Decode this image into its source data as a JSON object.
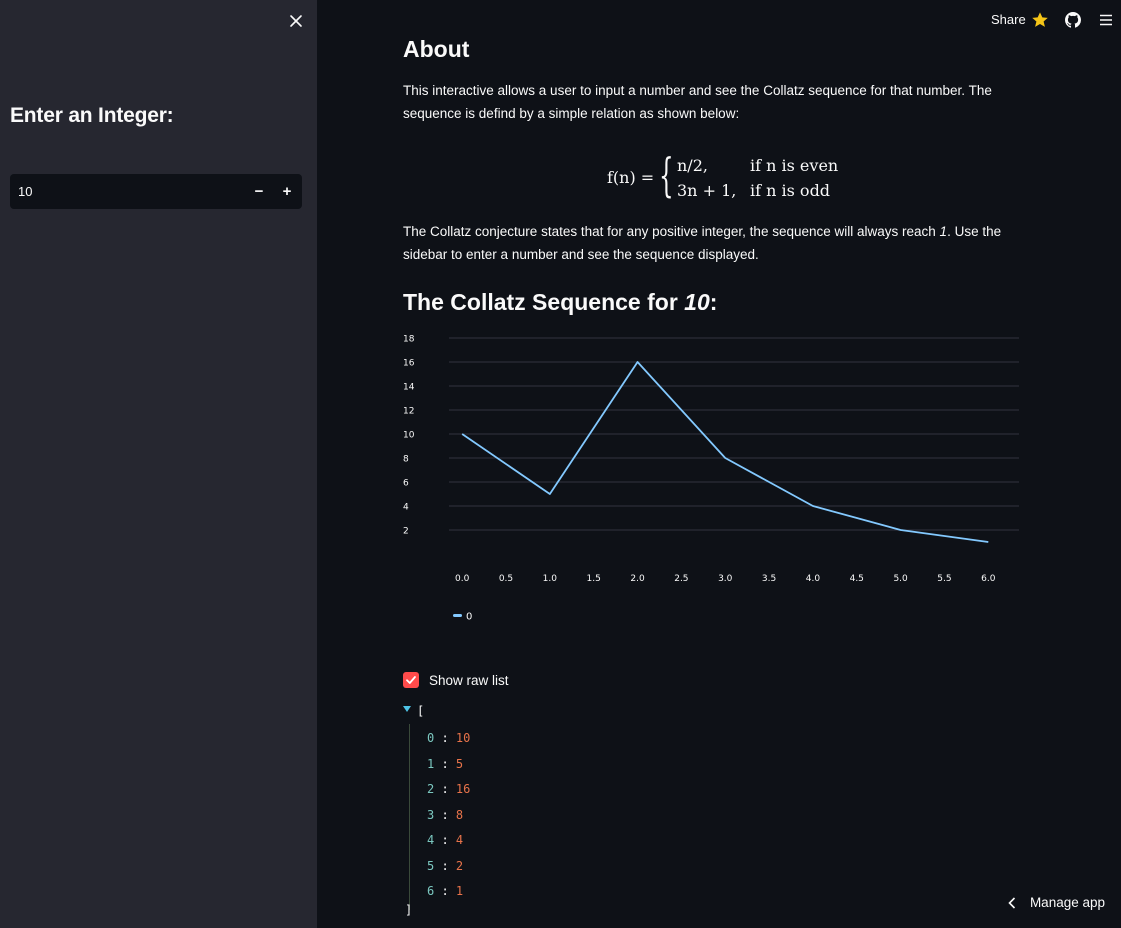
{
  "sidebar": {
    "title": "Enter an Integer:",
    "input_value": "10",
    "minus_label": "−",
    "plus_label": "+"
  },
  "topbar": {
    "share_label": "Share",
    "icons": [
      "star-icon",
      "github-icon",
      "hamburger-menu-icon"
    ],
    "star_color": "#f5c518"
  },
  "main": {
    "about_title": "About",
    "para1_line1": "This interactive allows a user to input a number and see the Collatz sequence for that number. The",
    "para1_line2": "sequence is defind by a simple relation as shown below:",
    "formula": {
      "lhs": "f(n) =",
      "row1_expr": "n/2,",
      "row1_cond": "if n is even",
      "row2_expr": "3n + 1,",
      "row2_cond": "if n is odd"
    },
    "para2_line1a": "The Collatz conjecture states that for any positive integer, the sequence will always reach ",
    "para2_line1_em": "1",
    "para2_line1b": ". Use the",
    "para2_line2": "sidebar to enter a number and see the sequence displayed.",
    "seq_title_prefix": "The Collatz Sequence for ",
    "seq_title_num": "10",
    "seq_title_suffix": ":",
    "checkbox_label": "Show raw list",
    "checkbox_checked": true,
    "manage_label": "Manage app"
  },
  "chart_data": {
    "type": "line",
    "x": [
      0,
      1,
      2,
      3,
      4,
      5,
      6
    ],
    "series": [
      {
        "name": "0",
        "values": [
          10,
          5,
          16,
          8,
          4,
          2,
          1
        ]
      }
    ],
    "x_ticks": [
      "0.0",
      "0.5",
      "1.0",
      "1.5",
      "2.0",
      "2.5",
      "3.0",
      "3.5",
      "4.0",
      "4.5",
      "5.0",
      "5.5",
      "6.0"
    ],
    "y_ticks": [
      "2",
      "4",
      "6",
      "8",
      "10",
      "12",
      "14",
      "16",
      "18"
    ],
    "xlim": [
      0,
      6
    ],
    "ylim": [
      1,
      18
    ],
    "grid": true,
    "legend": "bottom-left",
    "line_color": "#83c9ff"
  },
  "raw_list": {
    "open": "[",
    "close": "]",
    "items": [
      {
        "k": "0",
        "v": "10"
      },
      {
        "k": "1",
        "v": "5"
      },
      {
        "k": "2",
        "v": "16"
      },
      {
        "k": "3",
        "v": "8"
      },
      {
        "k": "4",
        "v": "4"
      },
      {
        "k": "5",
        "v": "2"
      },
      {
        "k": "6",
        "v": "1"
      }
    ]
  }
}
